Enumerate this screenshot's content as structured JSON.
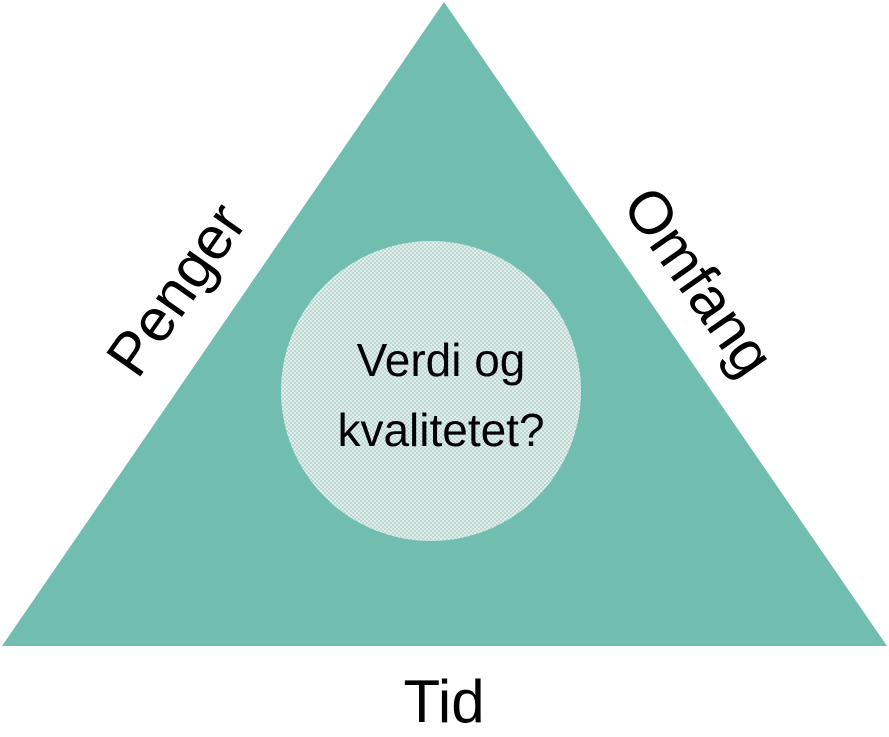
{
  "diagram": {
    "triangle_color": "#71BEB1",
    "circle_color": "#DCEEEA",
    "circle_dot_color": "#9FB8B3",
    "labels": {
      "left_side": "Penger",
      "right_side": "Omfang",
      "bottom": "Tid"
    },
    "center": {
      "line1": "Verdi og",
      "line2": "kvalitetet?"
    }
  }
}
